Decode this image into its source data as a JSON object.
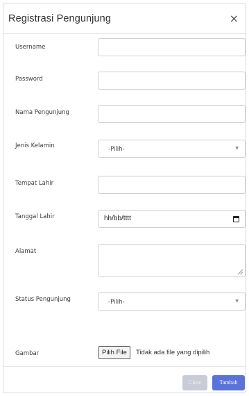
{
  "modal": {
    "title": "Registrasi Pengunjung",
    "close_glyph": "×"
  },
  "form": {
    "username": {
      "label": "Username",
      "value": ""
    },
    "password": {
      "label": "Password",
      "value": ""
    },
    "nama": {
      "label": "Nama Pengunjung",
      "value": ""
    },
    "jenis_kelamin": {
      "label": "Jenis Kelamin",
      "selected": "-Pilih-"
    },
    "tempat_lahir": {
      "label": "Tempat Lahir",
      "value": ""
    },
    "tanggal_lahir": {
      "label": "Tanggal Lahir",
      "placeholder": "hh/bb/tttt"
    },
    "alamat": {
      "label": "Alamat",
      "value": ""
    },
    "status": {
      "label": "Status Pengunjung",
      "selected": "-Pilih-"
    },
    "gambar": {
      "label": "Gambar",
      "button": "Pilih File",
      "status": "Tidak ada file yang dipilih"
    }
  },
  "footer": {
    "close_label": "Close",
    "add_label": "Tambah"
  },
  "colors": {
    "primary": "#5a73d9",
    "disabled": "#c9ccd6"
  }
}
